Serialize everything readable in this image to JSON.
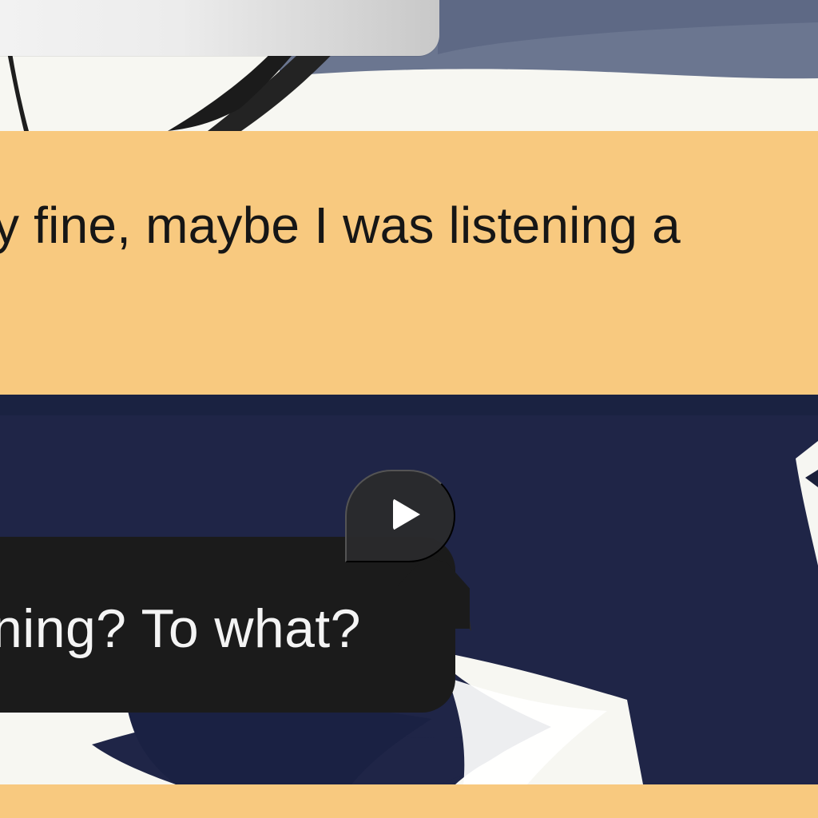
{
  "caption": {
    "text": "y fine, maybe I was listening a"
  },
  "message": {
    "text": "ning? To what?"
  },
  "media_control": {
    "icon": "play-icon"
  },
  "colors": {
    "caption_background": "#f8c97f",
    "message_background": "#1b1b1b",
    "scene_blue": "#1f2547",
    "scene_white": "#f7f7f2",
    "top_bubble_gray": "#ececec"
  }
}
